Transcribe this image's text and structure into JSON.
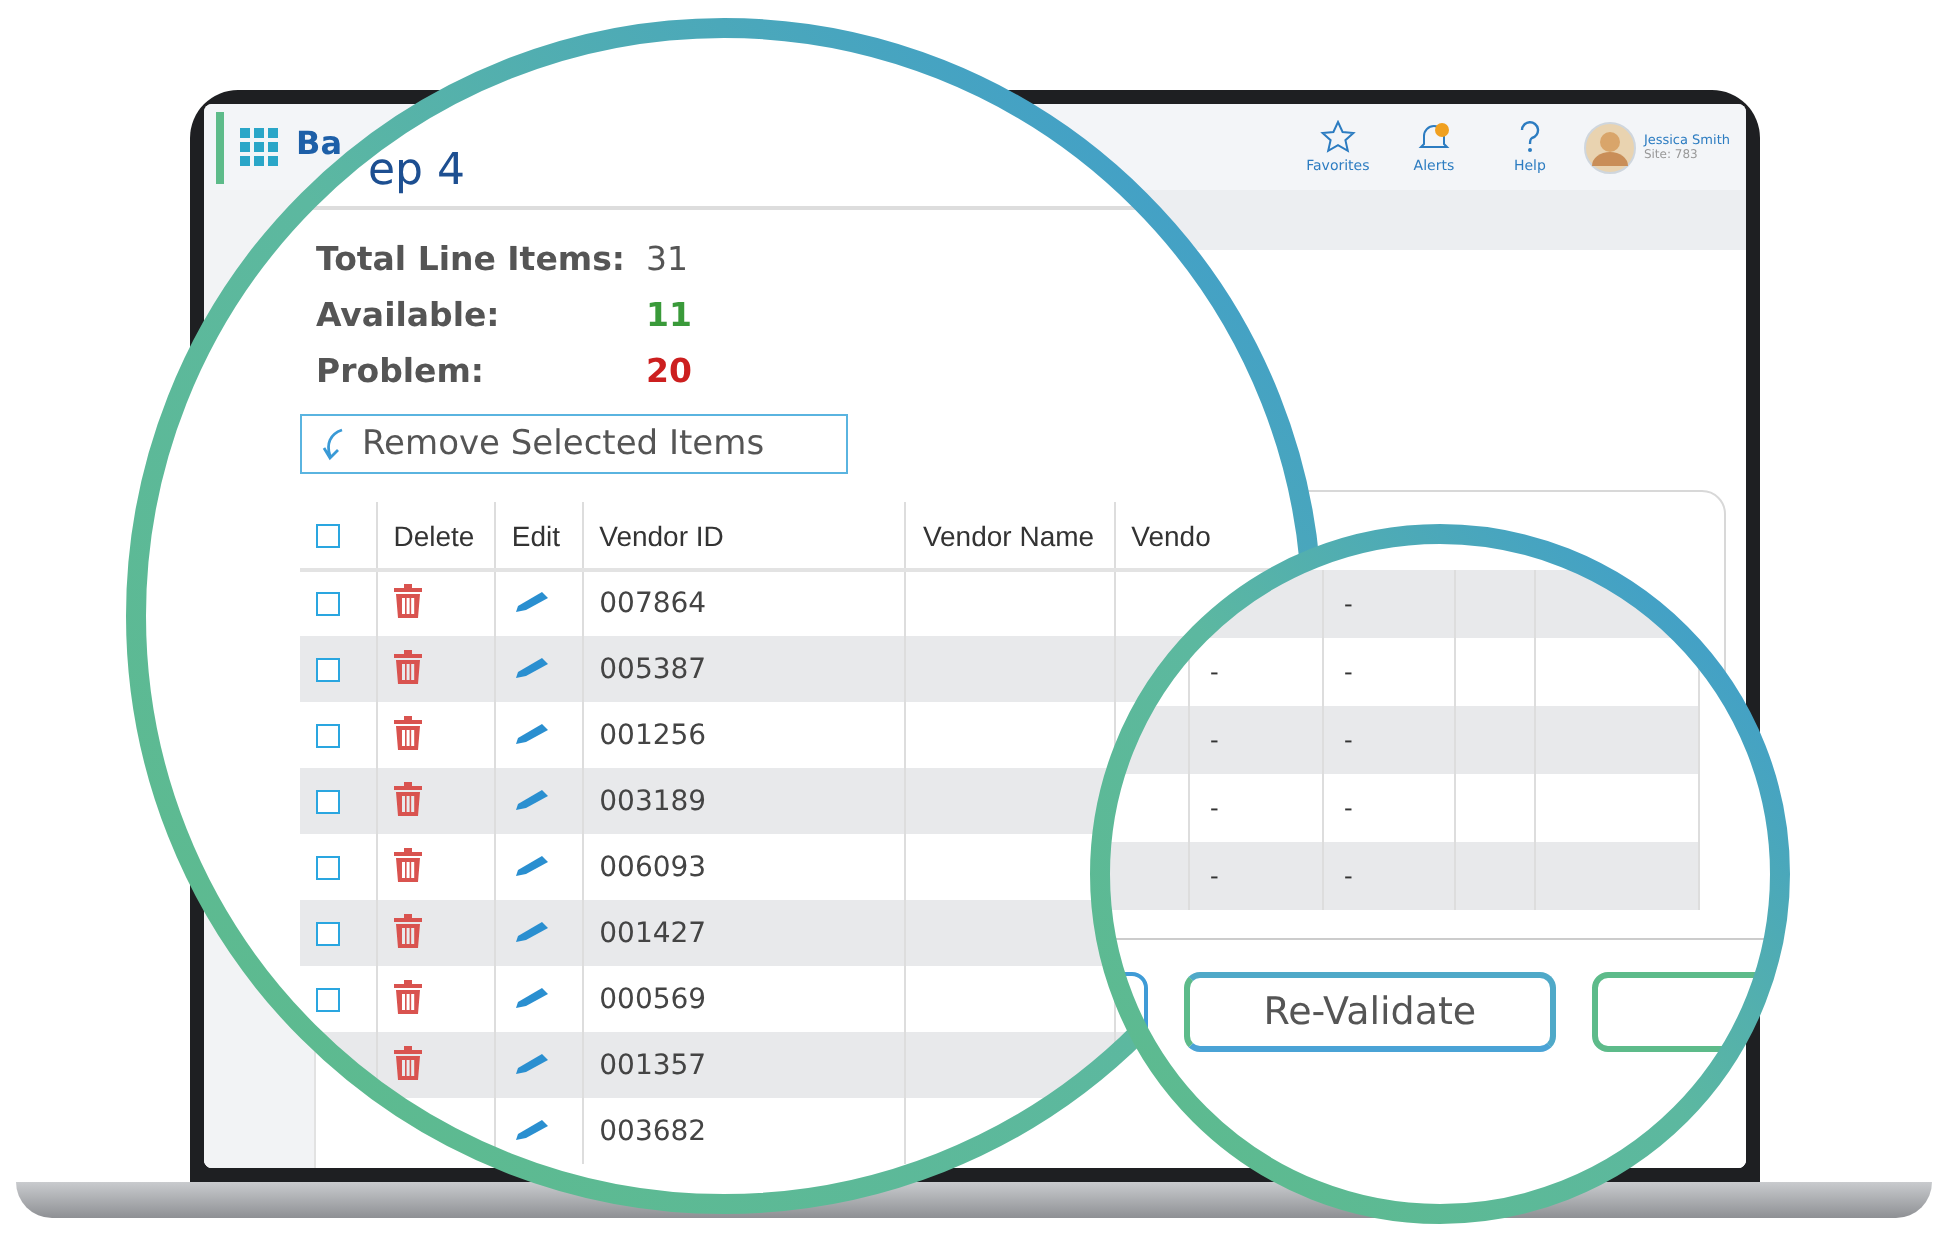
{
  "header": {
    "title": "Ba",
    "nav": [
      {
        "label": "Favorites",
        "kind": "star"
      },
      {
        "label": "Alerts",
        "kind": "bell"
      },
      {
        "label": "Help",
        "kind": "help"
      }
    ],
    "user": {
      "name": "Jessica Smith",
      "site": "Site: 783"
    }
  },
  "magnifier": {
    "title": "ep 4",
    "summary": [
      {
        "label": "Total Line Items:",
        "value": "31",
        "kind": "total"
      },
      {
        "label": "Available:",
        "value": "11",
        "kind": "ok"
      },
      {
        "label": "Problem:",
        "value": "20",
        "kind": "problem"
      }
    ],
    "remove_button": "Remove Selected Items",
    "table": {
      "header_checked": false,
      "columns": [
        "Delete",
        "Edit",
        "Vendor ID",
        "Vendor Name",
        "Vendo"
      ],
      "rows": [
        {
          "vendor_id": "007864",
          "checked": false,
          "deletable": true
        },
        {
          "vendor_id": "005387",
          "checked": false,
          "deletable": true
        },
        {
          "vendor_id": "001256",
          "checked": false,
          "deletable": true
        },
        {
          "vendor_id": "003189",
          "checked": false,
          "deletable": true
        },
        {
          "vendor_id": "006093",
          "checked": false,
          "deletable": true
        },
        {
          "vendor_id": "001427",
          "checked": false,
          "deletable": true
        },
        {
          "vendor_id": "000569",
          "checked": false,
          "deletable": true
        },
        {
          "vendor_id": "001357",
          "deletable": true
        },
        {
          "vendor_id": "003682"
        }
      ]
    }
  },
  "detail_magnifier": {
    "rows": [
      {
        "column_2": "-"
      },
      {
        "column_1": "-",
        "column_2": "-"
      },
      {
        "column_1": "-",
        "column_2": "-"
      },
      {
        "column_1": "-",
        "column_2": "-"
      },
      {
        "column_1": "-",
        "column_2": "-"
      }
    ],
    "button": "Re-Validate"
  }
}
